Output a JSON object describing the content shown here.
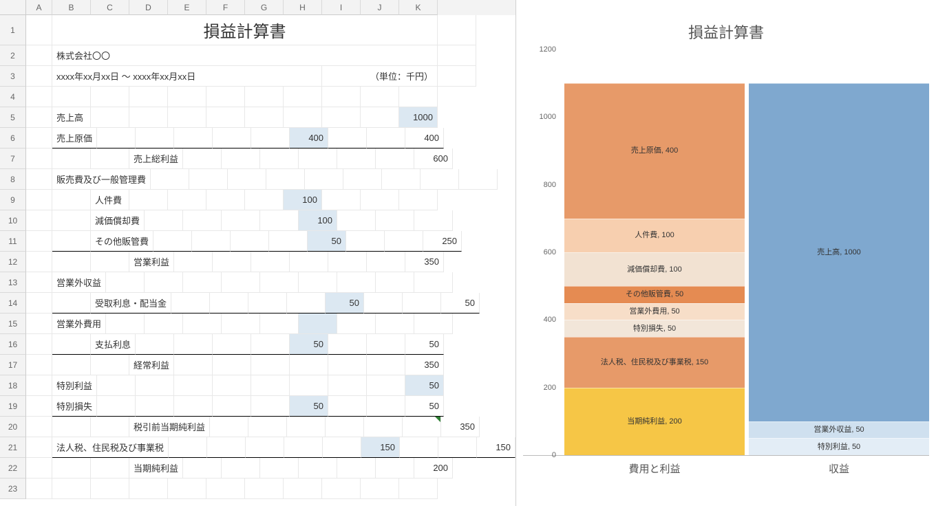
{
  "columns": [
    "",
    "A",
    "B",
    "C",
    "D",
    "E",
    "F",
    "G",
    "H",
    "I",
    "J",
    "K"
  ],
  "row_numbers": [
    1,
    2,
    3,
    4,
    5,
    6,
    7,
    8,
    9,
    10,
    11,
    12,
    13,
    14,
    15,
    16,
    17,
    18,
    19,
    20,
    21,
    22,
    23
  ],
  "title": "損益計算書",
  "company": "株式会社〇〇",
  "period": "xxxx年xx月xx日 〜 xxxx年xx月xx日",
  "unit": "（単位：千円）",
  "rows": {
    "r5": {
      "label": "売上高",
      "h": "",
      "k": "1000",
      "hl_k": true
    },
    "r6": {
      "label": "売上原価",
      "h": "400",
      "k": "400",
      "hl_h": true,
      "bb": true
    },
    "r7": {
      "ind": "D",
      "label": "売上総利益",
      "h": "",
      "k": "600"
    },
    "r8": {
      "label": "販売費及び一般管理費"
    },
    "r9": {
      "ind": "C",
      "label": "人件費",
      "h": "100",
      "hl_h": true
    },
    "r10": {
      "ind": "C",
      "label": "減価償却費",
      "h": "100",
      "hl_h": true
    },
    "r11": {
      "ind": "C",
      "label": "その他販管費",
      "h": "50",
      "k": "250",
      "hl_h": true,
      "bb": true
    },
    "r12": {
      "ind": "D",
      "label": "営業利益",
      "h": "",
      "k": "350"
    },
    "r13": {
      "label": "営業外収益"
    },
    "r14": {
      "ind": "C",
      "label": "受取利息・配当金",
      "h": "50",
      "k": "50",
      "hl_h": true,
      "bb": true
    },
    "r15": {
      "label": "営業外費用",
      "h": "",
      "hl_h": true
    },
    "r16": {
      "ind": "C",
      "label": "支払利息",
      "h": "50",
      "k": "50",
      "hl_h": true,
      "bb": true
    },
    "r17": {
      "ind": "D",
      "label": "経常利益",
      "h": "",
      "k": "350"
    },
    "r18": {
      "label": "特別利益",
      "h": "",
      "k": "50",
      "hl_k": true
    },
    "r19": {
      "label": "特別損失",
      "h": "50",
      "k": "50",
      "hl_h": true,
      "bb": true
    },
    "r20": {
      "ind": "D",
      "label": "税引前当期純利益",
      "h": "",
      "k": "350",
      "tri": true
    },
    "r21": {
      "label": "法人税、住民税及び事業税",
      "h": "150",
      "k": "150",
      "hl_h": true,
      "bb": true
    },
    "r22": {
      "ind": "D",
      "label": "当期純利益",
      "h": "",
      "k": "200"
    }
  },
  "chart_data": {
    "type": "bar",
    "title": "損益計算書",
    "ylim": [
      0,
      1200
    ],
    "yticks": [
      0,
      200,
      400,
      600,
      800,
      1000,
      1200
    ],
    "categories": [
      "費用と利益",
      "収益"
    ],
    "series": [
      {
        "cat": 0,
        "name": "当期純利益",
        "value": 200,
        "color": "c-yel"
      },
      {
        "cat": 0,
        "name": "法人税、住民税及び事業税",
        "value": 150,
        "color": "c-or7"
      },
      {
        "cat": 0,
        "name": "特別損失",
        "value": 50,
        "color": "c-or6"
      },
      {
        "cat": 0,
        "name": "営業外費用",
        "value": 50,
        "color": "c-or5"
      },
      {
        "cat": 0,
        "name": "その他販管費",
        "value": 50,
        "color": "c-or4"
      },
      {
        "cat": 0,
        "name": "減価償却費",
        "value": 100,
        "color": "c-or3"
      },
      {
        "cat": 0,
        "name": "人件費",
        "value": 100,
        "color": "c-or2"
      },
      {
        "cat": 0,
        "name": "売上原価",
        "value": 400,
        "color": "c-or1"
      },
      {
        "cat": 1,
        "name": "特別利益",
        "value": 50,
        "color": "c-bl3"
      },
      {
        "cat": 1,
        "name": "営業外収益",
        "value": 50,
        "color": "c-bl2"
      },
      {
        "cat": 1,
        "name": "売上高",
        "value": 1000,
        "color": "c-bl1"
      }
    ]
  }
}
